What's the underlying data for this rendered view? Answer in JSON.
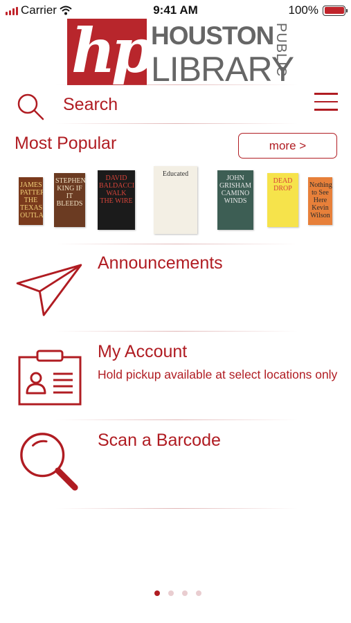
{
  "status_bar": {
    "carrier": "Carrier",
    "time": "9:41 AM",
    "battery": "100%"
  },
  "logo": {
    "mark": "hpl",
    "houston": "HOUSTON",
    "public": "PUBLIC",
    "library": "LIBRARY"
  },
  "search": {
    "label": "Search"
  },
  "popular": {
    "title": "Most Popular",
    "more_label": "more >",
    "books": [
      {
        "text": "JAMES PATTERSON THE TEXAS OUTLAW",
        "bg": "#7a3a1c",
        "fg": "#f2d27a"
      },
      {
        "text": "STEPHEN KING IF IT BLEEDS",
        "bg": "#6b3b22",
        "fg": "#f0e2c4"
      },
      {
        "text": "DAVID BALDACCI WALK THE WIRE",
        "bg": "#1b1b1b",
        "fg": "#d6443a"
      },
      {
        "text": "Educated",
        "bg": "#f3efe4",
        "fg": "#333333"
      },
      {
        "text": "JOHN GRISHAM CAMINO WINDS",
        "bg": "#3d5e54",
        "fg": "#e8e8e8"
      },
      {
        "text": "DEAD DROP",
        "bg": "#f6e34b",
        "fg": "#d8413a"
      },
      {
        "text": "Nothing to See Here Kevin Wilson",
        "bg": "#e7803a",
        "fg": "#2c2c2c"
      }
    ]
  },
  "announcements": {
    "title": "Announcements"
  },
  "account": {
    "title": "My Account",
    "subtitle": "Hold pickup available at select locations only"
  },
  "scan": {
    "title": "Scan a Barcode"
  },
  "pager": {
    "pages": 4,
    "active": 1
  },
  "colors": {
    "accent": "#b01c22",
    "logo_red": "#b8262c",
    "logo_gray": "#666666"
  },
  "icons": [
    "signal-icon",
    "wifi-icon",
    "battery-icon",
    "search-icon",
    "menu-icon",
    "paper-plane-icon",
    "id-card-icon",
    "magnifier-icon"
  ]
}
